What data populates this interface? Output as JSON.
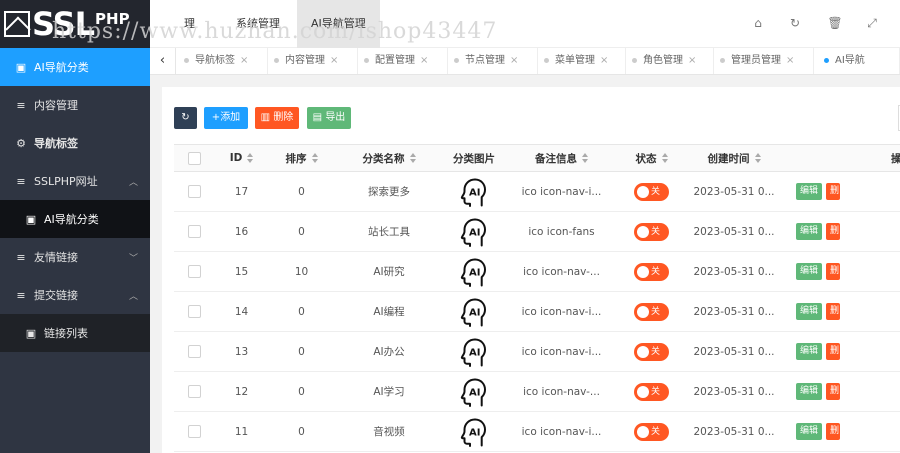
{
  "brand": {
    "name": "SSL",
    "suffix": "PHP"
  },
  "watermark": "https://www.huzhan.com/ishop43447",
  "header": {
    "tabs": [
      "理",
      "系统管理",
      "AI导航管理"
    ],
    "icons": [
      "home-icon",
      "refresh-icon",
      "trash-icon",
      "fullscreen-icon"
    ]
  },
  "sidebar": {
    "items": [
      {
        "label": "AI导航分类",
        "icon": "calendar-icon"
      },
      {
        "label": "内容管理",
        "icon": "list-icon"
      },
      {
        "label": "导航标签",
        "icon": "gear-icon"
      },
      {
        "label": "SSLPHP网址",
        "icon": "list-icon",
        "arrow": "^"
      },
      {
        "label": "AI导航分类",
        "icon": "calendar-icon"
      },
      {
        "label": "友情链接",
        "icon": "list-icon",
        "arrow": "v"
      },
      {
        "label": "提交链接",
        "icon": "list-icon",
        "arrow": "^"
      },
      {
        "label": "链接列表",
        "icon": "calendar-icon"
      }
    ]
  },
  "tabbar": {
    "prev": "‹",
    "tabs": [
      {
        "label": "导航标签"
      },
      {
        "label": "内容管理"
      },
      {
        "label": "配置管理"
      },
      {
        "label": "节点管理"
      },
      {
        "label": "菜单管理"
      },
      {
        "label": "角色管理"
      },
      {
        "label": "管理员管理"
      },
      {
        "label": "AI导航"
      }
    ]
  },
  "toolbar": {
    "add": "添加",
    "delete": "删除",
    "export": "导出"
  },
  "table": {
    "headers": {
      "id": "ID",
      "sort": "排序",
      "name": "分类名称",
      "image": "分类图片",
      "note": "备注信息",
      "status": "状态",
      "time": "创建时间",
      "ops": "操作"
    },
    "rows": [
      {
        "id": "17",
        "sort": "0",
        "name": "探索更多",
        "note": "ico icon-nav-i...",
        "status": "关",
        "time": "2023-05-31 0...",
        "edit": "编辑",
        "del": "删"
      },
      {
        "id": "16",
        "sort": "0",
        "name": "站长工具",
        "note": "ico icon-fans",
        "status": "关",
        "time": "2023-05-31 0...",
        "edit": "编辑",
        "del": "删"
      },
      {
        "id": "15",
        "sort": "10",
        "name": "AI研究",
        "note": "ico icon-nav-...",
        "status": "关",
        "time": "2023-05-31 0...",
        "edit": "编辑",
        "del": "删"
      },
      {
        "id": "14",
        "sort": "0",
        "name": "AI编程",
        "note": "ico icon-nav-i...",
        "status": "关",
        "time": "2023-05-31 0...",
        "edit": "编辑",
        "del": "删"
      },
      {
        "id": "13",
        "sort": "0",
        "name": "AI办公",
        "note": "ico icon-nav-i...",
        "status": "关",
        "time": "2023-05-31 0...",
        "edit": "编辑",
        "del": "删"
      },
      {
        "id": "12",
        "sort": "0",
        "name": "AI学习",
        "note": "ico icon-nav-...",
        "status": "关",
        "time": "2023-05-31 0...",
        "edit": "编辑",
        "del": "删"
      },
      {
        "id": "11",
        "sort": "0",
        "name": "音视频",
        "note": "ico icon-nav-i...",
        "status": "关",
        "time": "2023-05-31 0...",
        "edit": "编辑",
        "del": "删"
      }
    ]
  },
  "colors": {
    "primary": "#1e9fff",
    "danger": "#ff5722",
    "success": "#5fb878",
    "sidebar_bg": "#2f3542"
  }
}
